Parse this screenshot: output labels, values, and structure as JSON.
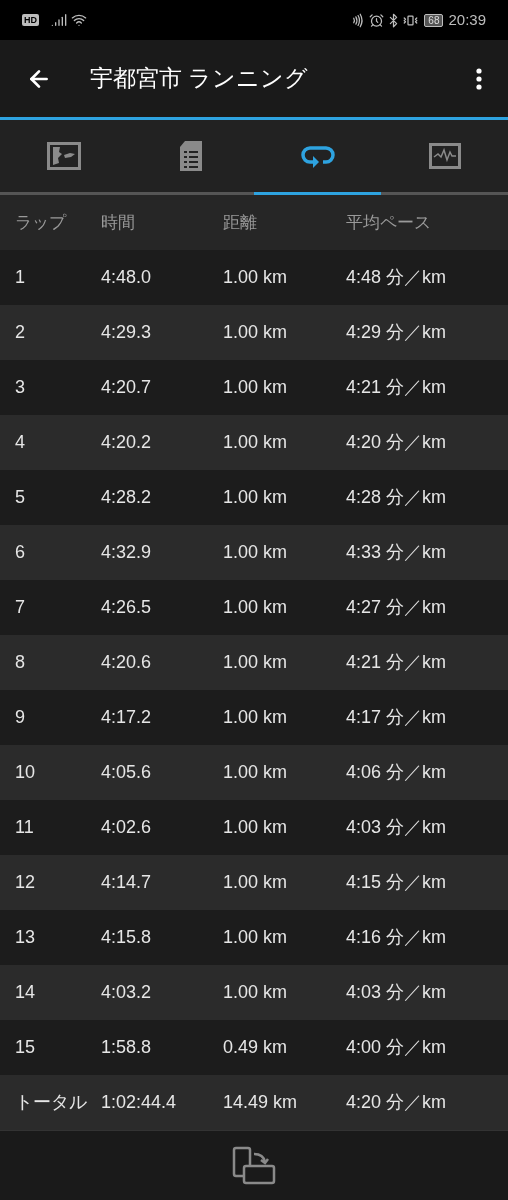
{
  "status_bar": {
    "badge": "HD",
    "battery": "68",
    "time": "20:39"
  },
  "app_bar": {
    "title": "宇都宮市 ランニング"
  },
  "tabs": [
    {
      "kind": "map",
      "selected": false
    },
    {
      "kind": "details",
      "selected": false
    },
    {
      "kind": "laps",
      "selected": true
    },
    {
      "kind": "chart",
      "selected": false
    }
  ],
  "table": {
    "columns": [
      "ラップ",
      "時間",
      "距離",
      "平均ペース"
    ],
    "rows": [
      [
        "1",
        "4:48.0",
        "1.00 km",
        "4:48 分／km"
      ],
      [
        "2",
        "4:29.3",
        "1.00 km",
        "4:29 分／km"
      ],
      [
        "3",
        "4:20.7",
        "1.00 km",
        "4:21 分／km"
      ],
      [
        "4",
        "4:20.2",
        "1.00 km",
        "4:20 分／km"
      ],
      [
        "5",
        "4:28.2",
        "1.00 km",
        "4:28 分／km"
      ],
      [
        "6",
        "4:32.9",
        "1.00 km",
        "4:33 分／km"
      ],
      [
        "7",
        "4:26.5",
        "1.00 km",
        "4:27 分／km"
      ],
      [
        "8",
        "4:20.6",
        "1.00 km",
        "4:21 分／km"
      ],
      [
        "9",
        "4:17.2",
        "1.00 km",
        "4:17 分／km"
      ],
      [
        "10",
        "4:05.6",
        "1.00 km",
        "4:06 分／km"
      ],
      [
        "11",
        "4:02.6",
        "1.00 km",
        "4:03 分／km"
      ],
      [
        "12",
        "4:14.7",
        "1.00 km",
        "4:15 分／km"
      ],
      [
        "13",
        "4:15.8",
        "1.00 km",
        "4:16 分／km"
      ],
      [
        "14",
        "4:03.2",
        "1.00 km",
        "4:03 分／km"
      ],
      [
        "15",
        "1:58.8",
        "0.49 km",
        "4:00 分／km"
      ]
    ],
    "total": [
      "トータル",
      "1:02:44.4",
      "14.49 km",
      "4:20 分／km"
    ]
  }
}
